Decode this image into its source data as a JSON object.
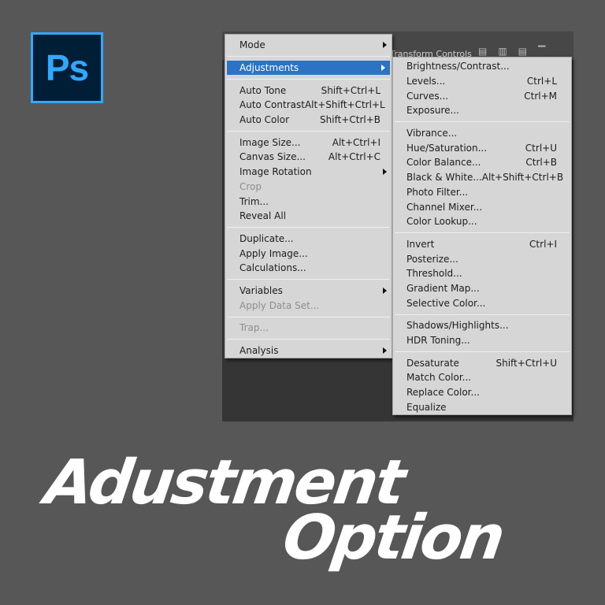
{
  "logo": "Ps",
  "toolbar": {
    "text": "Show Transform Controls"
  },
  "main_menu": [
    {
      "label": "Mode",
      "arrow": true
    },
    {
      "sep": true
    },
    {
      "label": "Adjustments",
      "arrow": true,
      "highlighted": true
    },
    {
      "sep": true
    },
    {
      "label": "Auto Tone",
      "shortcut": "Shift+Ctrl+L"
    },
    {
      "label": "Auto Contrast",
      "shortcut": "Alt+Shift+Ctrl+L"
    },
    {
      "label": "Auto Color",
      "shortcut": "Shift+Ctrl+B"
    },
    {
      "sep": true
    },
    {
      "label": "Image Size...",
      "shortcut": "Alt+Ctrl+I"
    },
    {
      "label": "Canvas Size...",
      "shortcut": "Alt+Ctrl+C"
    },
    {
      "label": "Image Rotation",
      "arrow": true
    },
    {
      "label": "Crop",
      "disabled": true
    },
    {
      "label": "Trim..."
    },
    {
      "label": "Reveal All"
    },
    {
      "sep": true
    },
    {
      "label": "Duplicate..."
    },
    {
      "label": "Apply Image..."
    },
    {
      "label": "Calculations..."
    },
    {
      "sep": true
    },
    {
      "label": "Variables",
      "arrow": true
    },
    {
      "label": "Apply Data Set...",
      "disabled": true
    },
    {
      "sep": true
    },
    {
      "label": "Trap...",
      "disabled": true
    },
    {
      "sep": true
    },
    {
      "label": "Analysis",
      "arrow": true
    }
  ],
  "sub_menu": [
    {
      "label": "Brightness/Contrast..."
    },
    {
      "label": "Levels...",
      "shortcut": "Ctrl+L"
    },
    {
      "label": "Curves...",
      "shortcut": "Ctrl+M"
    },
    {
      "label": "Exposure..."
    },
    {
      "sep": true
    },
    {
      "label": "Vibrance..."
    },
    {
      "label": "Hue/Saturation...",
      "shortcut": "Ctrl+U"
    },
    {
      "label": "Color Balance...",
      "shortcut": "Ctrl+B"
    },
    {
      "label": "Black & White...",
      "shortcut": "Alt+Shift+Ctrl+B"
    },
    {
      "label": "Photo Filter..."
    },
    {
      "label": "Channel Mixer..."
    },
    {
      "label": "Color Lookup..."
    },
    {
      "sep": true
    },
    {
      "label": "Invert",
      "shortcut": "Ctrl+I"
    },
    {
      "label": "Posterize..."
    },
    {
      "label": "Threshold..."
    },
    {
      "label": "Gradient Map..."
    },
    {
      "label": "Selective Color..."
    },
    {
      "sep": true
    },
    {
      "label": "Shadows/Highlights..."
    },
    {
      "label": "HDR Toning..."
    },
    {
      "sep": true
    },
    {
      "label": "Desaturate",
      "shortcut": "Shift+Ctrl+U"
    },
    {
      "label": "Match Color..."
    },
    {
      "label": "Replace Color..."
    },
    {
      "label": "Equalize"
    }
  ],
  "headline": {
    "line1": "Adustment",
    "line2": "Option"
  },
  "colors": {
    "highlight": "#2c73c4",
    "logo_bg": "#001e36",
    "logo_fg": "#31a8ff"
  }
}
